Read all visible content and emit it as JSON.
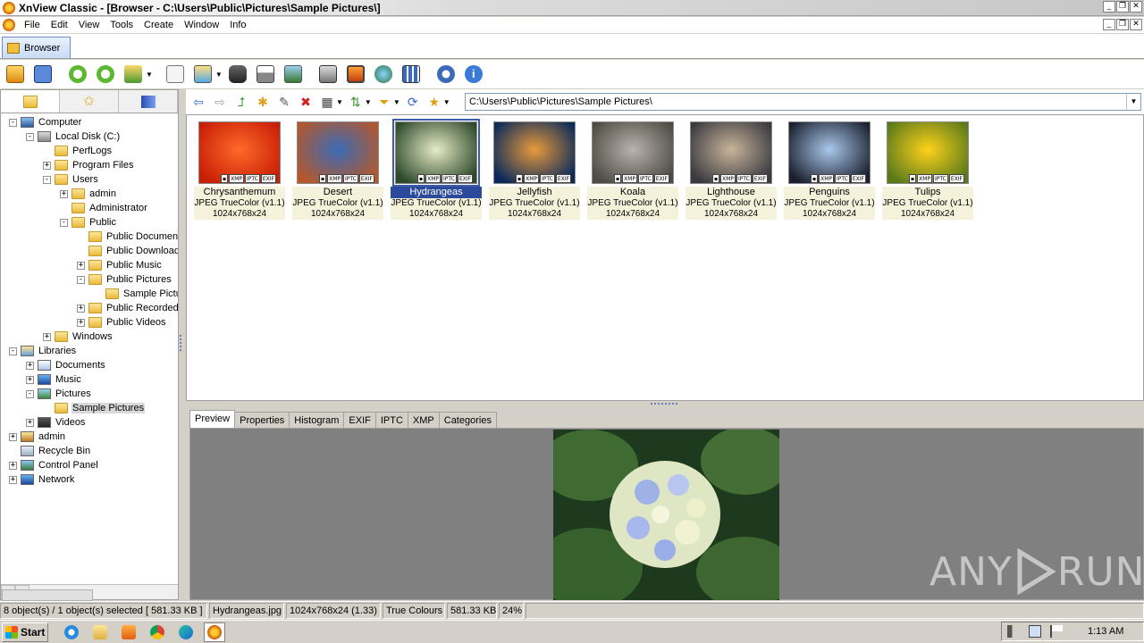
{
  "window": {
    "title": "XnView Classic - [Browser - C:\\Users\\Public\\Pictures\\Sample Pictures\\]"
  },
  "menu": [
    "File",
    "Edit",
    "View",
    "Tools",
    "Create",
    "Window",
    "Info"
  ],
  "tabs": {
    "browser": "Browser"
  },
  "nav": {
    "path": "C:\\Users\\Public\\Pictures\\Sample Pictures\\"
  },
  "tree": [
    {
      "label": "Computer",
      "depth": 0,
      "exp": "-",
      "icon": "computer-icon"
    },
    {
      "label": "Local Disk (C:)",
      "depth": 1,
      "exp": "-",
      "icon": "disk-icon"
    },
    {
      "label": "PerfLogs",
      "depth": 2,
      "exp": "",
      "icon": "folder-icon"
    },
    {
      "label": "Program Files",
      "depth": 2,
      "exp": "+",
      "icon": "folder-icon"
    },
    {
      "label": "Users",
      "depth": 2,
      "exp": "-",
      "icon": "folder-icon"
    },
    {
      "label": "admin",
      "depth": 3,
      "exp": "+",
      "icon": "folder-icon"
    },
    {
      "label": "Administrator",
      "depth": 3,
      "exp": "",
      "icon": "folder-icon"
    },
    {
      "label": "Public",
      "depth": 3,
      "exp": "-",
      "icon": "folder-icon"
    },
    {
      "label": "Public Documents",
      "depth": 4,
      "exp": "",
      "icon": "folder-icon"
    },
    {
      "label": "Public Downloads",
      "depth": 4,
      "exp": "",
      "icon": "folder-icon"
    },
    {
      "label": "Public Music",
      "depth": 4,
      "exp": "+",
      "icon": "folder-icon"
    },
    {
      "label": "Public Pictures",
      "depth": 4,
      "exp": "-",
      "icon": "folder-icon"
    },
    {
      "label": "Sample Pictures",
      "depth": 5,
      "exp": "",
      "icon": "folder-icon"
    },
    {
      "label": "Public Recorded TV",
      "depth": 4,
      "exp": "+",
      "icon": "folder-icon"
    },
    {
      "label": "Public Videos",
      "depth": 4,
      "exp": "+",
      "icon": "folder-icon"
    },
    {
      "label": "Windows",
      "depth": 2,
      "exp": "+",
      "icon": "folder-icon"
    },
    {
      "label": "Libraries",
      "depth": 0,
      "exp": "-",
      "icon": "library-icon"
    },
    {
      "label": "Documents",
      "depth": 1,
      "exp": "+",
      "icon": "documents-icon"
    },
    {
      "label": "Music",
      "depth": 1,
      "exp": "+",
      "icon": "music-icon"
    },
    {
      "label": "Pictures",
      "depth": 1,
      "exp": "-",
      "icon": "pictures-icon"
    },
    {
      "label": "Sample Pictures",
      "depth": 2,
      "exp": "",
      "icon": "folder-icon",
      "selected": true
    },
    {
      "label": "Videos",
      "depth": 1,
      "exp": "+",
      "icon": "videos-icon"
    },
    {
      "label": "admin",
      "depth": 0,
      "exp": "+",
      "icon": "user-icon"
    },
    {
      "label": "Recycle Bin",
      "depth": 0,
      "exp": "",
      "icon": "recycle-bin-icon"
    },
    {
      "label": "Control Panel",
      "depth": 0,
      "exp": "+",
      "icon": "control-panel-icon"
    },
    {
      "label": "Network",
      "depth": 0,
      "exp": "+",
      "icon": "network-icon"
    }
  ],
  "thumbnails": [
    {
      "name": "Chrysanthemum",
      "format": "JPEG TrueColor (v1.1)",
      "dims": "1024x768x24",
      "colors": [
        "#ff6a2a",
        "#c81e05"
      ]
    },
    {
      "name": "Desert",
      "format": "JPEG TrueColor (v1.1)",
      "dims": "1024x768x24",
      "colors": [
        "#3a6bb8",
        "#b5582a"
      ]
    },
    {
      "name": "Hydrangeas",
      "format": "JPEG TrueColor (v1.1)",
      "dims": "1024x768x24",
      "colors": [
        "#e6ecc8",
        "#2d4a2a"
      ],
      "selected": true
    },
    {
      "name": "Jellyfish",
      "format": "JPEG TrueColor (v1.1)",
      "dims": "1024x768x24",
      "colors": [
        "#e89a3c",
        "#0a2a5a"
      ]
    },
    {
      "name": "Koala",
      "format": "JPEG TrueColor (v1.1)",
      "dims": "1024x768x24",
      "colors": [
        "#b8b4ac",
        "#4e4a44"
      ]
    },
    {
      "name": "Lighthouse",
      "format": "JPEG TrueColor (v1.1)",
      "dims": "1024x768x24",
      "colors": [
        "#c9b49a",
        "#3a3a40"
      ]
    },
    {
      "name": "Penguins",
      "format": "JPEG TrueColor (v1.1)",
      "dims": "1024x768x24",
      "colors": [
        "#aac8ea",
        "#1a2030"
      ]
    },
    {
      "name": "Tulips",
      "format": "JPEG TrueColor (v1.1)",
      "dims": "1024x768x24",
      "colors": [
        "#ffd21a",
        "#5a7a1a"
      ]
    }
  ],
  "badges": [
    "XMP",
    "IPTC",
    "EXIF"
  ],
  "bottom_tabs": [
    "Preview",
    "Properties",
    "Histogram",
    "EXIF",
    "IPTC",
    "XMP",
    "Categories"
  ],
  "status": {
    "objects": "8 object(s) / 1 object(s) selected  [ 581.33 KB ]",
    "file": "Hydrangeas.jpg",
    "dims": "1024x768x24 (1.33)",
    "colours": "True Colours",
    "size": "581.33 KB",
    "zoom": "24%"
  },
  "taskbar": {
    "start": "Start",
    "clock": "1:13 AM"
  },
  "watermark": {
    "left": "ANY",
    "right": "RUN"
  }
}
